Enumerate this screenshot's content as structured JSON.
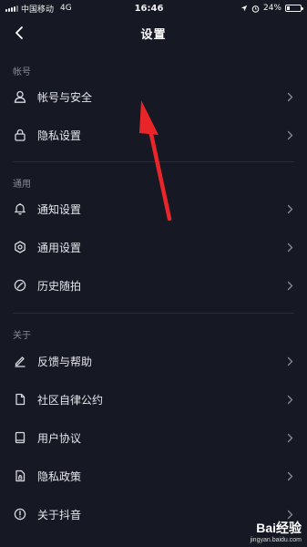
{
  "status_bar": {
    "carrier": "中国移动",
    "network": "4G",
    "time": "16:46",
    "battery": "24%",
    "battery_level": 0.24
  },
  "header": {
    "title": "设置"
  },
  "sections": [
    {
      "label": "帐号",
      "items": [
        {
          "label": "帐号与安全",
          "icon": "user-icon"
        },
        {
          "label": "隐私设置",
          "icon": "lock-icon"
        }
      ]
    },
    {
      "label": "通用",
      "items": [
        {
          "label": "通知设置",
          "icon": "bell-icon"
        },
        {
          "label": "通用设置",
          "icon": "gear-icon"
        },
        {
          "label": "历史随拍",
          "icon": "history-icon"
        }
      ]
    },
    {
      "label": "关于",
      "items": [
        {
          "label": "反馈与帮助",
          "icon": "pen-icon"
        },
        {
          "label": "社区自律公约",
          "icon": "document-icon"
        },
        {
          "label": "用户协议",
          "icon": "book-icon"
        },
        {
          "label": "隐私政策",
          "icon": "privacy-document-icon"
        },
        {
          "label": "关于抖音",
          "icon": "info-icon"
        }
      ]
    }
  ],
  "annotation": {
    "color": "#e8262a"
  },
  "watermark": {
    "brand": "Bai经验",
    "url": "jingyan.baidu.com"
  },
  "colors": {
    "background": "#161823",
    "text": "#e6e6ec",
    "section_label": "#8a8b94",
    "divider": "#2a2c38"
  }
}
